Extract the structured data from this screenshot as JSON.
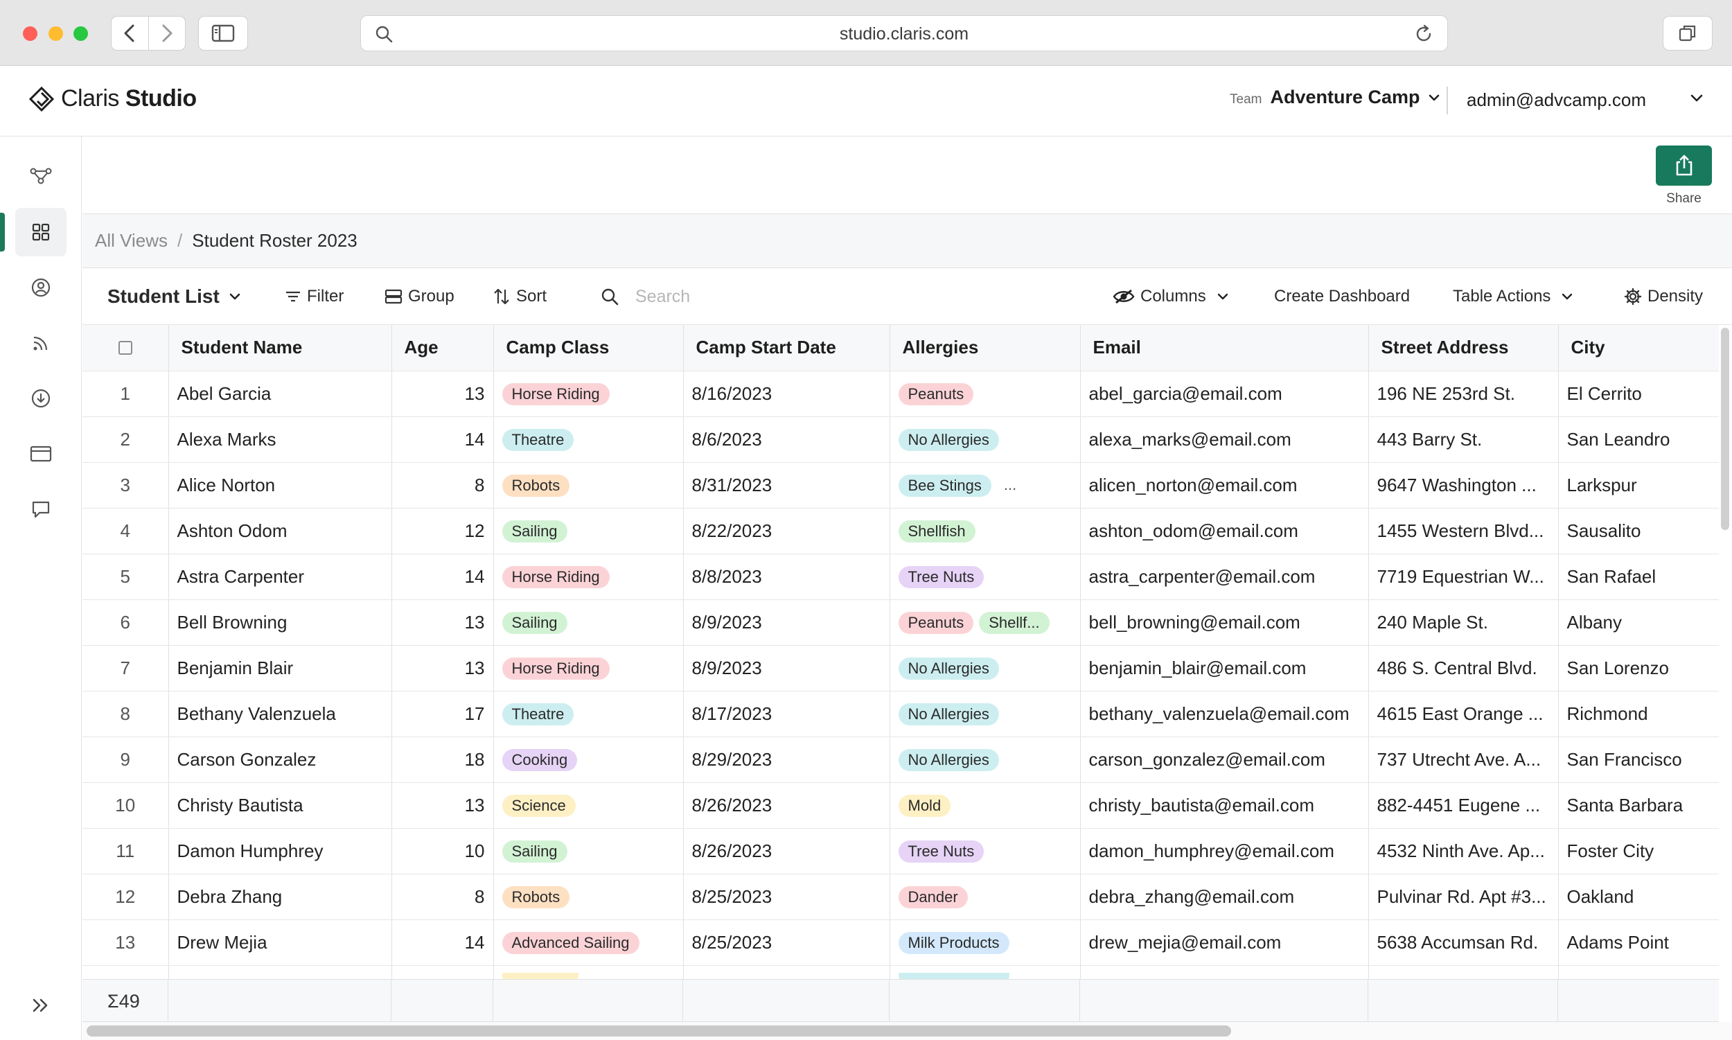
{
  "browser": {
    "url": "studio.claris.com",
    "icons": [
      "back-icon",
      "forward-icon",
      "sidebar-icon",
      "search-icon",
      "reload-icon",
      "tabs-icon"
    ]
  },
  "app": {
    "logo_prefix": "Claris",
    "logo_suffix": "Studio",
    "team_label": "Team",
    "team_name": "Adventure Camp",
    "user_email": "admin@advcamp.com",
    "accent": "#177a5c"
  },
  "share": {
    "label": "Share"
  },
  "breadcrumb": {
    "root": "All Views",
    "separator": "/",
    "current": "Student Roster 2023"
  },
  "toolbar": {
    "view_name": "Student List",
    "filter": "Filter",
    "group": "Group",
    "sort": "Sort",
    "search_placeholder": "Search",
    "columns": "Columns",
    "create_dashboard": "Create Dashboard",
    "table_actions": "Table Actions",
    "density": "Density"
  },
  "table": {
    "columns": [
      "Student Name",
      "Age",
      "Camp Class",
      "Camp Start Date",
      "Allergies",
      "Email",
      "Street Address",
      "City"
    ],
    "chip_colors": {
      "Horse Riding": "#fbd3d6",
      "Theatre": "#cdeef0",
      "Robots": "#fde0c2",
      "Sailing": "#d2f2d4",
      "Cooking": "#e6d3f6",
      "Science": "#fdf0c4",
      "Advanced Sailing": "#fbd3d6",
      "Peanuts": "#fbd3d6",
      "No Allergies": "#cdeef0",
      "Bee Stings": "#cdeef0",
      "Shellfish": "#d2f2d4",
      "Shellf...": "#d2f2d4",
      "Tree Nuts": "#e6d3f6",
      "Mold": "#fdf0c4",
      "Dander": "#fbd3d6",
      "Milk Products": "#d3e9fb"
    },
    "rows": [
      {
        "n": "1",
        "name": "Abel Garcia",
        "age": "13",
        "camp_class": "Horse Riding",
        "start": "8/16/2023",
        "allergies": [
          "Peanuts"
        ],
        "more": false,
        "email": "abel_garcia@email.com",
        "address": "196 NE 253rd St.",
        "city": "El Cerrito"
      },
      {
        "n": "2",
        "name": "Alexa Marks",
        "age": "14",
        "camp_class": "Theatre",
        "start": "8/6/2023",
        "allergies": [
          "No Allergies"
        ],
        "more": false,
        "email": "alexa_marks@email.com",
        "address": "443 Barry St.",
        "city": "San Leandro"
      },
      {
        "n": "3",
        "name": "Alice Norton",
        "age": "8",
        "camp_class": "Robots",
        "start": "8/31/2023",
        "allergies": [
          "Bee Stings"
        ],
        "more": true,
        "email": "alicen_norton@email.com",
        "address": "9647 Washington ...",
        "city": "Larkspur"
      },
      {
        "n": "4",
        "name": "Ashton Odom",
        "age": "12",
        "camp_class": "Sailing",
        "start": "8/22/2023",
        "allergies": [
          "Shellfish"
        ],
        "more": false,
        "email": "ashton_odom@email.com",
        "address": "1455 Western Blvd...",
        "city": "Sausalito"
      },
      {
        "n": "5",
        "name": "Astra Carpenter",
        "age": "14",
        "camp_class": "Horse Riding",
        "start": "8/8/2023",
        "allergies": [
          "Tree Nuts"
        ],
        "more": false,
        "email": "astra_carpenter@email.com",
        "address": "7719 Equestrian W...",
        "city": "San Rafael"
      },
      {
        "n": "6",
        "name": "Bell Browning",
        "age": "13",
        "camp_class": "Sailing",
        "start": "8/9/2023",
        "allergies": [
          "Peanuts",
          "Shellf..."
        ],
        "more": false,
        "email": "bell_browning@email.com",
        "address": "240 Maple St.",
        "city": "Albany"
      },
      {
        "n": "7",
        "name": "Benjamin Blair",
        "age": "13",
        "camp_class": "Horse Riding",
        "start": "8/9/2023",
        "allergies": [
          "No Allergies"
        ],
        "more": false,
        "email": "benjamin_blair@email.com",
        "address": "486 S. Central Blvd.",
        "city": "San Lorenzo"
      },
      {
        "n": "8",
        "name": "Bethany Valenzuela",
        "age": "17",
        "camp_class": "Theatre",
        "start": "8/17/2023",
        "allergies": [
          "No Allergies"
        ],
        "more": false,
        "email": "bethany_valenzuela@email.com",
        "address": "4615 East Orange ...",
        "city": "Richmond"
      },
      {
        "n": "9",
        "name": "Carson Gonzalez",
        "age": "18",
        "camp_class": "Cooking",
        "start": "8/29/2023",
        "allergies": [
          "No Allergies"
        ],
        "more": false,
        "email": "carson_gonzalez@email.com",
        "address": "737 Utrecht Ave. A...",
        "city": "San Francisco"
      },
      {
        "n": "10",
        "name": "Christy Bautista",
        "age": "13",
        "camp_class": "Science",
        "start": "8/26/2023",
        "allergies": [
          "Mold"
        ],
        "more": false,
        "email": "christy_bautista@email.com",
        "address": "882-4451 Eugene ...",
        "city": "Santa Barbara"
      },
      {
        "n": "11",
        "name": "Damon Humphrey",
        "age": "10",
        "camp_class": "Sailing",
        "start": "8/26/2023",
        "allergies": [
          "Tree Nuts"
        ],
        "more": false,
        "email": "damon_humphrey@email.com",
        "address": "4532 Ninth Ave. Ap...",
        "city": "Foster City"
      },
      {
        "n": "12",
        "name": "Debra Zhang",
        "age": "8",
        "camp_class": "Robots",
        "start": "8/25/2023",
        "allergies": [
          "Dander"
        ],
        "more": false,
        "email": "debra_zhang@email.com",
        "address": "Pulvinar Rd. Apt #3...",
        "city": "Oakland"
      },
      {
        "n": "13",
        "name": "Drew Mejia",
        "age": "14",
        "camp_class": "Advanced Sailing",
        "start": "8/25/2023",
        "allergies": [
          "Milk Products"
        ],
        "more": false,
        "email": "drew_mejia@email.com",
        "address": "5638 Accumsan Rd.",
        "city": "Adams Point"
      }
    ],
    "more_label": "...",
    "total_count": "Σ49"
  }
}
